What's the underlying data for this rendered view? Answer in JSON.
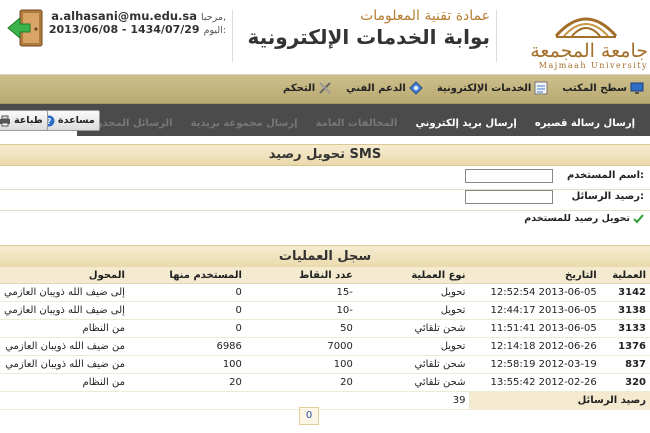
{
  "header": {
    "greeting_label": "مرحبا,",
    "email": "a.alhasani@mu.edu.sa",
    "date_label": "اليوم:",
    "date_value": "2013/06/08 - 1434/07/29",
    "dean_title": "عمادة تقنية المعلومات",
    "portal_title": "بوابة الخدمات الإلكترونية",
    "logo_arabic": "جامعة المجمعة",
    "logo_english": "Majmaah University"
  },
  "menubar": {
    "items": [
      {
        "label": "سطح المكتب",
        "icon": "desktop-icon"
      },
      {
        "label": "الخدمات الإلكترونية",
        "icon": "services-icon"
      },
      {
        "label": "الدعم الفني",
        "icon": "support-icon"
      },
      {
        "label": "التحكم",
        "icon": "tools-icon"
      }
    ]
  },
  "tabs": [
    {
      "label": "إرسال رسالة قصيره",
      "state": "normal"
    },
    {
      "label": "إرسال بريد إلكتروني",
      "state": "normal"
    },
    {
      "label": "المخالفات العامة",
      "state": "dim"
    },
    {
      "label": "إرسال مجموعة بريدية",
      "state": "dim"
    },
    {
      "label": "الرسائل المجدولة",
      "state": "dim"
    },
    {
      "label": "رصيد الرسائل",
      "state": "active"
    }
  ],
  "toolbar": {
    "help_label": "مساعدة",
    "print_label": "طباعة"
  },
  "sms_panel": {
    "title": "تحويل رصيد SMS",
    "username_label": "اسم المستخدم:",
    "username_value": "",
    "balance_label": "رصيد الرسائل:",
    "balance_value": "",
    "transfer_link": "تحويل رصيد للمستخدم"
  },
  "operations": {
    "title": "سجل العمليات",
    "columns": [
      "العملية",
      "التاريخ",
      "نوع العملية",
      "عدد النقاط",
      "المستخدم منها",
      "المحول"
    ],
    "rows": [
      {
        "id": "3142",
        "date": "2013-06-05 12:52:54",
        "type": "تحويل",
        "points": "-15",
        "used": "0",
        "from": "إلى ضيف الله ذويبان العازمي"
      },
      {
        "id": "3138",
        "date": "2013-06-05 12:44:17",
        "type": "تحويل",
        "points": "-10",
        "used": "0",
        "from": "إلى ضيف الله ذويبان العازمي"
      },
      {
        "id": "3133",
        "date": "2013-06-05 11:51:41",
        "type": "شحن تلقائي",
        "points": "50",
        "used": "0",
        "from": "من النظام"
      },
      {
        "id": "1376",
        "date": "2012-06-26 12:14:18",
        "type": "تحويل",
        "points": "7000",
        "used": "6986",
        "from": "من ضيف الله ذويبان العازمي"
      },
      {
        "id": "837",
        "date": "2012-03-19 12:58:19",
        "type": "شحن تلقائي",
        "points": "100",
        "used": "100",
        "from": "من ضيف الله ذويبان العازمي"
      },
      {
        "id": "320",
        "date": "2012-02-26 13:55:42",
        "type": "شحن تلقائي",
        "points": "20",
        "used": "20",
        "from": "من النظام"
      }
    ],
    "total_label": "رصيد الرسائل",
    "total_value": "39",
    "page": "0"
  }
}
